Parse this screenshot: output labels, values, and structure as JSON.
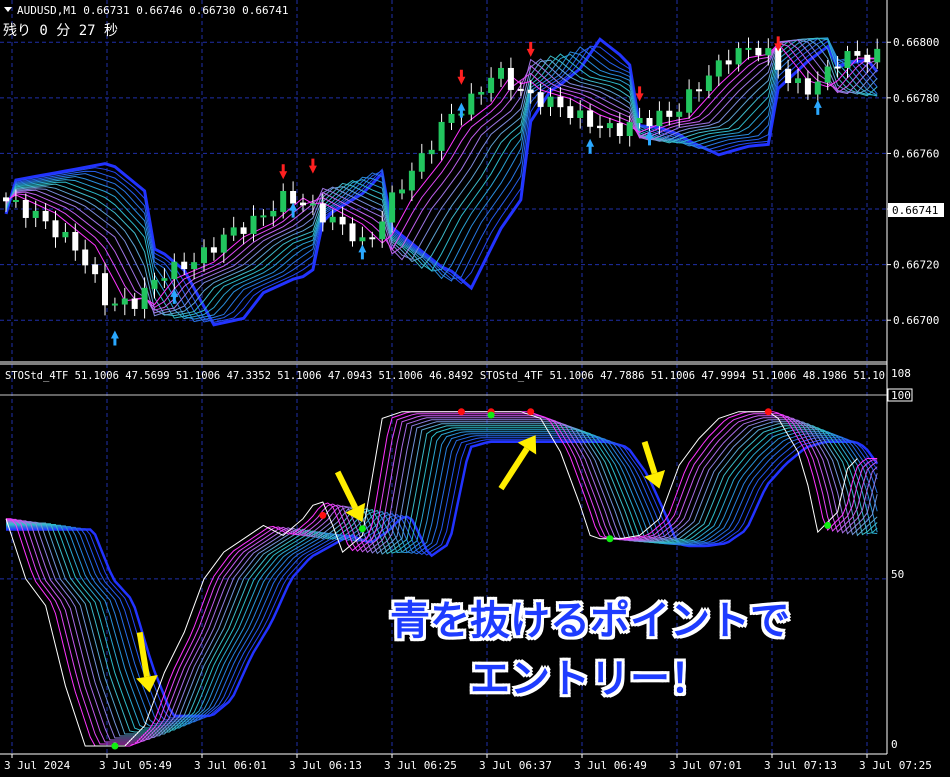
{
  "window": {
    "symbol_line": "AUDUSD,M1  0.66731 0.66746 0.66730 0.66741",
    "countdown": "残り 0 分 27 秒"
  },
  "colors": {
    "background": "#000000",
    "grid": "#1f2fa8",
    "bull_candle": "#22c55e",
    "bear_candle": "#ffffff",
    "ribbon_fast": "#ff33ff",
    "ribbon_mid": "#2ec4c4",
    "ribbon_slow": "#2233ff",
    "sell_arrow": "#ff2020",
    "buy_arrow": "#2aa8ff",
    "stoch_line": "#ffffff",
    "marker_red": "#ff1010",
    "marker_green": "#10ee10",
    "callout_arrow": "#ffee00"
  },
  "indicator_header": "STOStd_4TF 51.1006 47.5699 51.1006 47.3352 51.1006 47.0943 51.1006 46.8492  STOStd_4TF 51.1006 47.7886 51.1006 47.9994 51.1006 48.1986 51.10",
  "annotation": {
    "line1": "青を抜けるポイントで",
    "line2": "エントリー！"
  },
  "chart_data": [
    {
      "type": "line",
      "title": "AUDUSD,M1",
      "subtype": "candlestick",
      "x_ticks": [
        "3 Jul 2024",
        "3 Jul 05:49",
        "3 Jul 06:01",
        "3 Jul 06:13",
        "3 Jul 06:25",
        "3 Jul 06:37",
        "3 Jul 06:49",
        "3 Jul 07:01",
        "3 Jul 07:13",
        "3 Jul 07:25"
      ],
      "ylim": [
        0.6669,
        0.66808
      ],
      "y_ticks": [
        "0.66800",
        "0.66780",
        "0.66760",
        "0.66740",
        "0.66720",
        "0.66700"
      ],
      "current_price": "0.66741",
      "grid": true,
      "price_path": [
        [
          0,
          0.66744
        ],
        [
          4,
          0.66737
        ],
        [
          8,
          0.66725
        ],
        [
          11,
          0.66705
        ],
        [
          14,
          0.66707
        ],
        [
          16,
          0.66716
        ],
        [
          20,
          0.66722
        ],
        [
          23,
          0.66731
        ],
        [
          26,
          0.66736
        ],
        [
          29,
          0.66745
        ],
        [
          31,
          0.66741
        ],
        [
          35,
          0.66733
        ],
        [
          37,
          0.66726
        ],
        [
          40,
          0.66746
        ],
        [
          43,
          0.6676
        ],
        [
          45,
          0.66772
        ],
        [
          48,
          0.6678
        ],
        [
          50,
          0.6679
        ],
        [
          53,
          0.66781
        ],
        [
          56,
          0.66778
        ],
        [
          59,
          0.66772
        ],
        [
          62,
          0.66768
        ],
        [
          65,
          0.66772
        ],
        [
          68,
          0.66774
        ],
        [
          71,
          0.66786
        ],
        [
          74,
          0.66796
        ],
        [
          77,
          0.66798
        ],
        [
          80,
          0.66785
        ],
        [
          82,
          0.66783
        ],
        [
          85,
          0.66795
        ]
      ],
      "ribbon_offsets": [
        [
          0,
          8e-05
        ],
        [
          11,
          0.00018
        ],
        [
          16,
          0.0001
        ],
        [
          29,
          8e-05
        ],
        [
          37,
          0.00014
        ],
        [
          44,
          0.00022
        ],
        [
          50,
          0.00018
        ],
        [
          56,
          0.00014
        ],
        [
          62,
          0.00016
        ],
        [
          68,
          0.0001
        ],
        [
          77,
          0.00014
        ],
        [
          85,
          6e-05
        ]
      ],
      "sell_arrows": [
        [
          28,
          0.6675
        ],
        [
          31,
          0.66752
        ],
        [
          46,
          0.66784
        ],
        [
          53,
          0.66794
        ],
        [
          64,
          0.66778
        ],
        [
          78,
          0.66796
        ]
      ],
      "buy_arrows": [
        [
          11,
          0.66697
        ],
        [
          17,
          0.66712
        ],
        [
          29,
          0.66743
        ],
        [
          36,
          0.66728
        ],
        [
          46,
          0.66779
        ],
        [
          59,
          0.66766
        ],
        [
          65,
          0.66769
        ],
        [
          82,
          0.6678
        ]
      ]
    },
    {
      "type": "line",
      "title": "STOStd_4TF",
      "ylim": [
        0,
        108
      ],
      "y_ticks": [
        "108",
        "100",
        "50",
        "0"
      ],
      "level_line": 100,
      "grid": true,
      "x": [
        0,
        2,
        4,
        6,
        8,
        10,
        12,
        14,
        16,
        18,
        20,
        22,
        24,
        26,
        28,
        30,
        31,
        32,
        33,
        34,
        36,
        38,
        40,
        42,
        44,
        46,
        48,
        50,
        52,
        54,
        56,
        58,
        59,
        60,
        62,
        64,
        66,
        68,
        70,
        72,
        74,
        76,
        77,
        78,
        80,
        81,
        82,
        84,
        85,
        86
      ],
      "stoch_values": [
        68,
        50,
        42,
        18,
        0,
        0,
        0,
        6,
        22,
        34,
        50,
        58,
        62,
        66,
        63,
        68,
        72,
        73,
        66,
        58,
        63,
        98,
        100,
        100,
        100,
        100,
        100,
        100,
        100,
        98,
        88,
        72,
        63,
        62,
        62,
        63,
        68,
        84,
        92,
        98,
        100,
        100,
        100,
        98,
        88,
        78,
        64,
        70,
        83,
        86
      ],
      "ribbon_offsets": [
        [
          0,
          -6
        ],
        [
          10,
          -30
        ],
        [
          18,
          -20
        ],
        [
          30,
          -8
        ],
        [
          38,
          -26
        ],
        [
          46,
          -4
        ],
        [
          54,
          -20
        ],
        [
          62,
          -14
        ],
        [
          70,
          -20
        ],
        [
          78,
          -4
        ],
        [
          86,
          -12
        ]
      ],
      "red_dots": [
        [
          32,
          69
        ],
        [
          46,
          100
        ],
        [
          49,
          100
        ],
        [
          53,
          100
        ],
        [
          77,
          100
        ]
      ],
      "green_dots": [
        [
          11,
          0
        ],
        [
          36,
          65
        ],
        [
          49,
          99
        ],
        [
          61,
          62
        ],
        [
          83,
          66
        ]
      ],
      "callout_arrows": [
        {
          "tip": [
            14.5,
            16
          ],
          "tail": [
            13.5,
            34
          ]
        },
        {
          "tip": [
            36,
            67
          ],
          "tail": [
            33.5,
            82
          ]
        },
        {
          "tip": [
            53.5,
            93
          ],
          "tail": [
            50,
            77
          ]
        },
        {
          "tip": [
            66,
            77
          ],
          "tail": [
            64.5,
            91
          ]
        }
      ]
    }
  ]
}
